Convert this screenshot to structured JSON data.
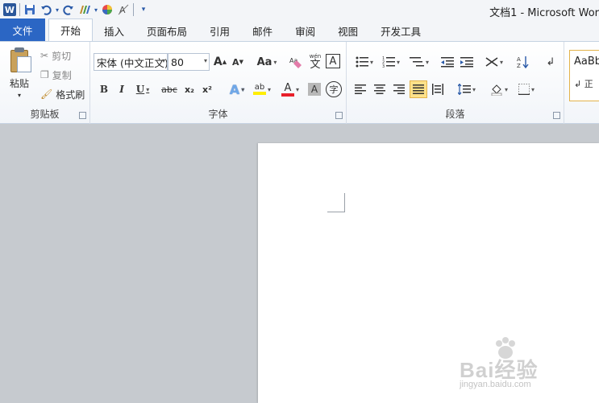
{
  "window": {
    "title": "文档1 - Microsoft Wor",
    "app_icon": "W"
  },
  "qat": {
    "icons": [
      "word-icon",
      "save-icon",
      "undo-icon",
      "redo-icon",
      "format-painter-icon",
      "color-wheel-icon",
      "clear-format-icon",
      "customize-icon"
    ]
  },
  "tabs": [
    {
      "label": "文件"
    },
    {
      "label": "开始"
    },
    {
      "label": "插入"
    },
    {
      "label": "页面布局"
    },
    {
      "label": "引用"
    },
    {
      "label": "邮件"
    },
    {
      "label": "审阅"
    },
    {
      "label": "视图"
    },
    {
      "label": "开发工具"
    }
  ],
  "clipboard": {
    "paste": "粘贴",
    "cut": "剪切",
    "copy": "复制",
    "format_painter": "格式刷",
    "group_label": "剪贴板"
  },
  "font": {
    "font_name": "宋体 (中文正文)",
    "font_size": "80",
    "group_label": "字体",
    "grow": "A",
    "shrink": "A",
    "change_case": "Aa",
    "phonetic_top": "wén",
    "phonetic_main": "文",
    "border_char": "A",
    "bold": "B",
    "italic": "I",
    "underline": "U",
    "strike": "abc",
    "subscript": "x₂",
    "superscript": "x²",
    "text_effect": "A",
    "highlight": "ab",
    "font_color": "A",
    "char_shading": "A",
    "enclose": "字"
  },
  "paragraph": {
    "group_label": "段落"
  },
  "styles": {
    "sample": "AaBb",
    "name": "↲ 正"
  },
  "watermark": {
    "brand": "Bai经验",
    "url": "jingyan.baidu.com"
  },
  "colors": {
    "file_tab": "#2b66c4",
    "highlight_on": "#fde18a",
    "font_red": "#e8202a",
    "highlight_yellow": "#ffee00"
  }
}
